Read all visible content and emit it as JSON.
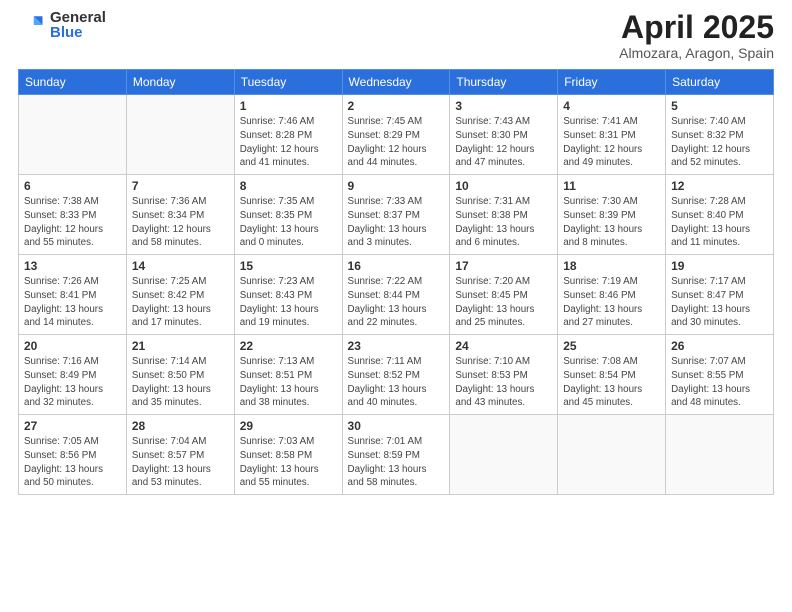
{
  "logo": {
    "general": "General",
    "blue": "Blue"
  },
  "title": "April 2025",
  "subtitle": "Almozara, Aragon, Spain",
  "days_of_week": [
    "Sunday",
    "Monday",
    "Tuesday",
    "Wednesday",
    "Thursday",
    "Friday",
    "Saturday"
  ],
  "weeks": [
    [
      {
        "day": null
      },
      {
        "day": null
      },
      {
        "day": "1",
        "sunrise": "7:46 AM",
        "sunset": "8:28 PM",
        "daylight": "12 hours and 41 minutes."
      },
      {
        "day": "2",
        "sunrise": "7:45 AM",
        "sunset": "8:29 PM",
        "daylight": "12 hours and 44 minutes."
      },
      {
        "day": "3",
        "sunrise": "7:43 AM",
        "sunset": "8:30 PM",
        "daylight": "12 hours and 47 minutes."
      },
      {
        "day": "4",
        "sunrise": "7:41 AM",
        "sunset": "8:31 PM",
        "daylight": "12 hours and 49 minutes."
      },
      {
        "day": "5",
        "sunrise": "7:40 AM",
        "sunset": "8:32 PM",
        "daylight": "12 hours and 52 minutes."
      }
    ],
    [
      {
        "day": "6",
        "sunrise": "7:38 AM",
        "sunset": "8:33 PM",
        "daylight": "12 hours and 55 minutes."
      },
      {
        "day": "7",
        "sunrise": "7:36 AM",
        "sunset": "8:34 PM",
        "daylight": "12 hours and 58 minutes."
      },
      {
        "day": "8",
        "sunrise": "7:35 AM",
        "sunset": "8:35 PM",
        "daylight": "13 hours and 0 minutes."
      },
      {
        "day": "9",
        "sunrise": "7:33 AM",
        "sunset": "8:37 PM",
        "daylight": "13 hours and 3 minutes."
      },
      {
        "day": "10",
        "sunrise": "7:31 AM",
        "sunset": "8:38 PM",
        "daylight": "13 hours and 6 minutes."
      },
      {
        "day": "11",
        "sunrise": "7:30 AM",
        "sunset": "8:39 PM",
        "daylight": "13 hours and 8 minutes."
      },
      {
        "day": "12",
        "sunrise": "7:28 AM",
        "sunset": "8:40 PM",
        "daylight": "13 hours and 11 minutes."
      }
    ],
    [
      {
        "day": "13",
        "sunrise": "7:26 AM",
        "sunset": "8:41 PM",
        "daylight": "13 hours and 14 minutes."
      },
      {
        "day": "14",
        "sunrise": "7:25 AM",
        "sunset": "8:42 PM",
        "daylight": "13 hours and 17 minutes."
      },
      {
        "day": "15",
        "sunrise": "7:23 AM",
        "sunset": "8:43 PM",
        "daylight": "13 hours and 19 minutes."
      },
      {
        "day": "16",
        "sunrise": "7:22 AM",
        "sunset": "8:44 PM",
        "daylight": "13 hours and 22 minutes."
      },
      {
        "day": "17",
        "sunrise": "7:20 AM",
        "sunset": "8:45 PM",
        "daylight": "13 hours and 25 minutes."
      },
      {
        "day": "18",
        "sunrise": "7:19 AM",
        "sunset": "8:46 PM",
        "daylight": "13 hours and 27 minutes."
      },
      {
        "day": "19",
        "sunrise": "7:17 AM",
        "sunset": "8:47 PM",
        "daylight": "13 hours and 30 minutes."
      }
    ],
    [
      {
        "day": "20",
        "sunrise": "7:16 AM",
        "sunset": "8:49 PM",
        "daylight": "13 hours and 32 minutes."
      },
      {
        "day": "21",
        "sunrise": "7:14 AM",
        "sunset": "8:50 PM",
        "daylight": "13 hours and 35 minutes."
      },
      {
        "day": "22",
        "sunrise": "7:13 AM",
        "sunset": "8:51 PM",
        "daylight": "13 hours and 38 minutes."
      },
      {
        "day": "23",
        "sunrise": "7:11 AM",
        "sunset": "8:52 PM",
        "daylight": "13 hours and 40 minutes."
      },
      {
        "day": "24",
        "sunrise": "7:10 AM",
        "sunset": "8:53 PM",
        "daylight": "13 hours and 43 minutes."
      },
      {
        "day": "25",
        "sunrise": "7:08 AM",
        "sunset": "8:54 PM",
        "daylight": "13 hours and 45 minutes."
      },
      {
        "day": "26",
        "sunrise": "7:07 AM",
        "sunset": "8:55 PM",
        "daylight": "13 hours and 48 minutes."
      }
    ],
    [
      {
        "day": "27",
        "sunrise": "7:05 AM",
        "sunset": "8:56 PM",
        "daylight": "13 hours and 50 minutes."
      },
      {
        "day": "28",
        "sunrise": "7:04 AM",
        "sunset": "8:57 PM",
        "daylight": "13 hours and 53 minutes."
      },
      {
        "day": "29",
        "sunrise": "7:03 AM",
        "sunset": "8:58 PM",
        "daylight": "13 hours and 55 minutes."
      },
      {
        "day": "30",
        "sunrise": "7:01 AM",
        "sunset": "8:59 PM",
        "daylight": "13 hours and 58 minutes."
      },
      {
        "day": null
      },
      {
        "day": null
      },
      {
        "day": null
      }
    ]
  ],
  "labels": {
    "sunrise": "Sunrise:",
    "sunset": "Sunset:",
    "daylight": "Daylight:"
  }
}
